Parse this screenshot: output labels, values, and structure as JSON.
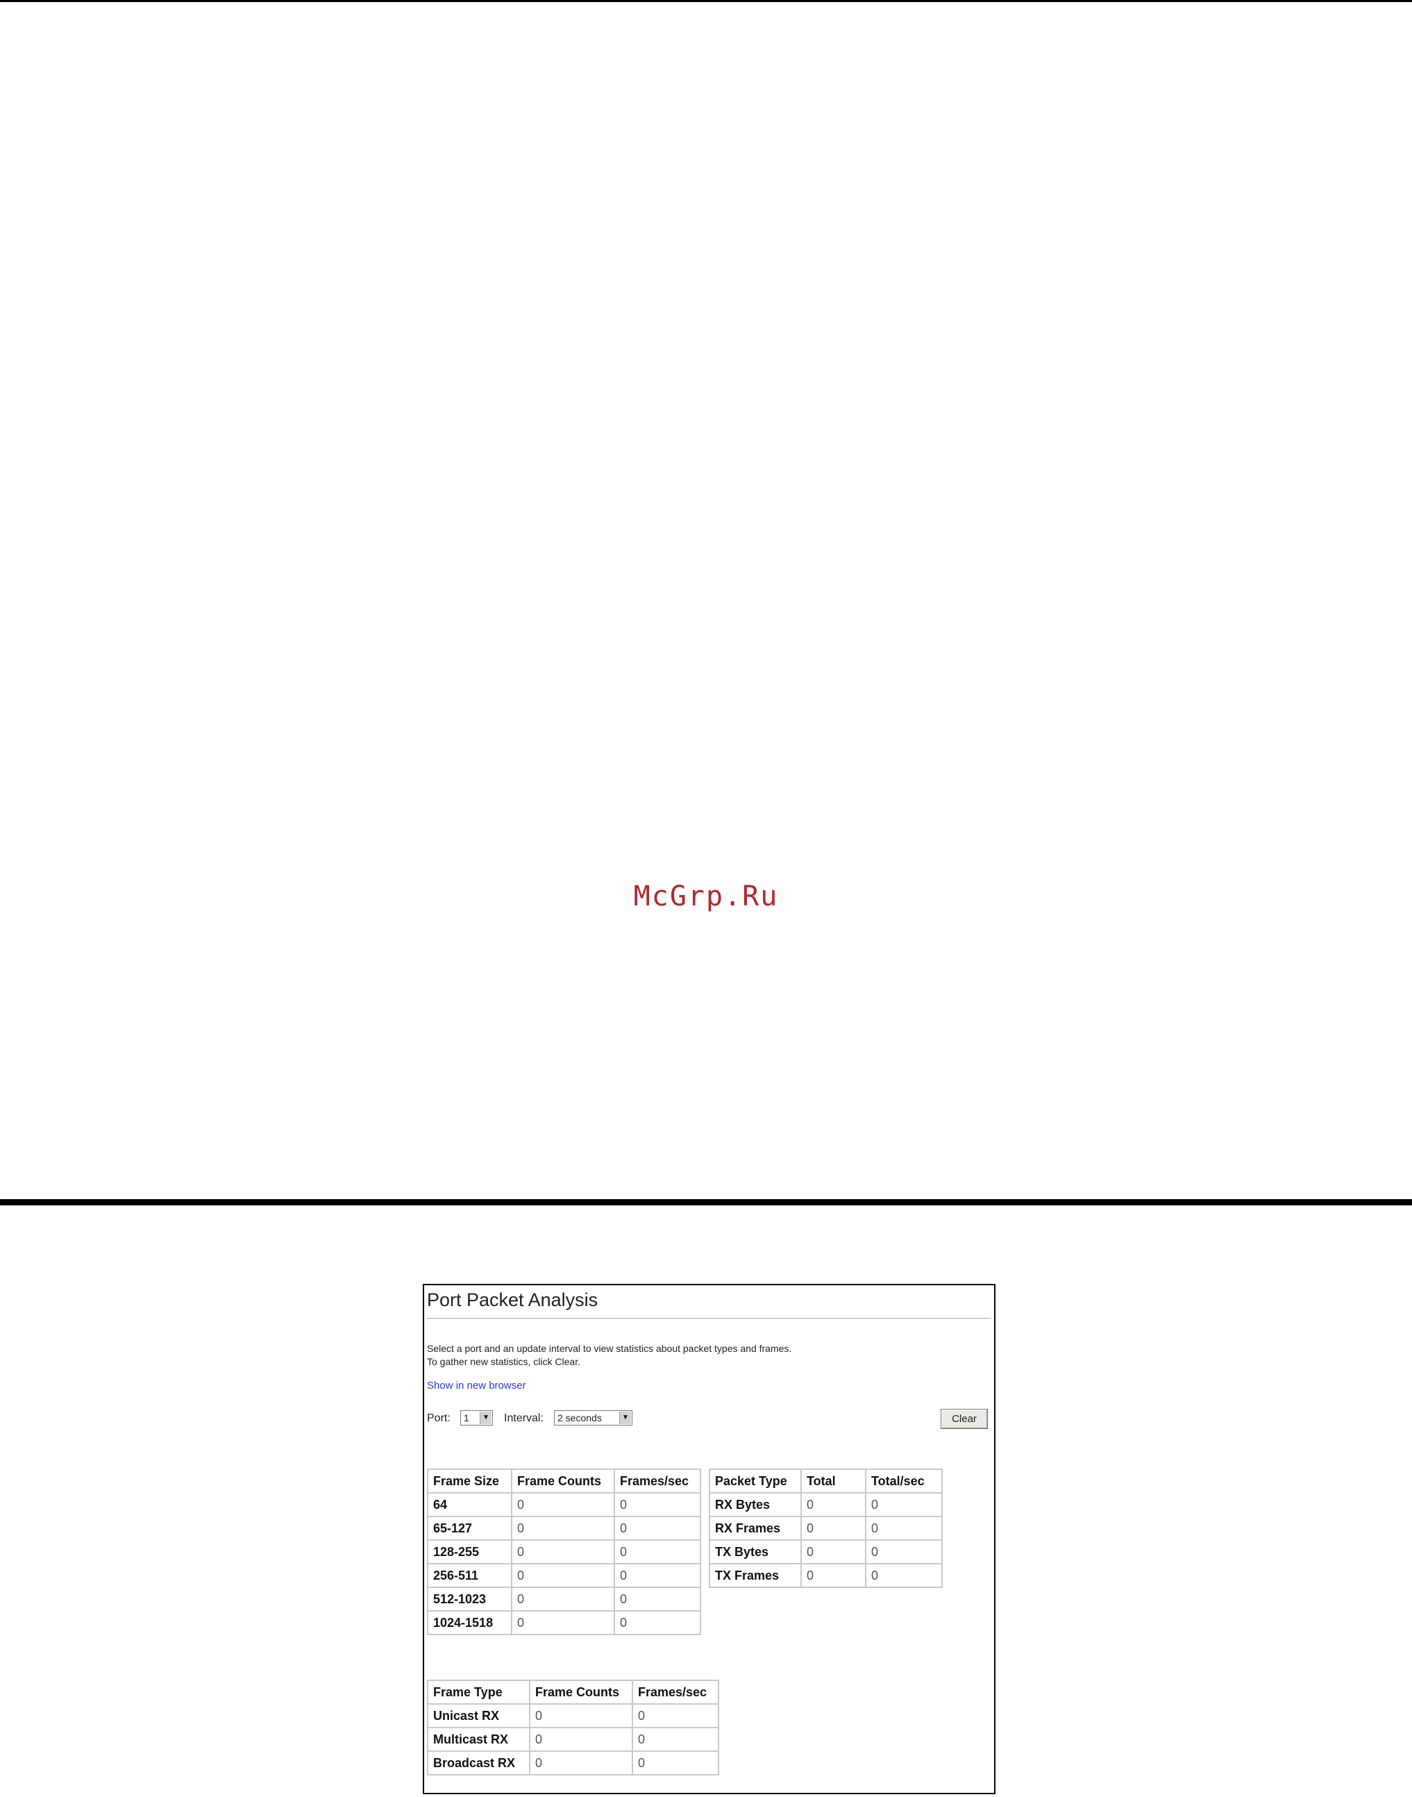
{
  "watermark": "McGrp.Ru",
  "panel": {
    "title": "Port Packet Analysis",
    "description_line1": "Select a port and an update interval to view statistics about packet types and frames.",
    "description_line2": "To gather new statistics, click Clear.",
    "link": "Show in new browser",
    "port_label": "Port:",
    "port_value": "1",
    "interval_label": "Interval:",
    "interval_value": "2 seconds",
    "clear_label": "Clear"
  },
  "frame_size_table": {
    "headers": [
      "Frame Size",
      "Frame Counts",
      "Frames/sec"
    ],
    "rows": [
      [
        "64",
        "0",
        "0"
      ],
      [
        "65-127",
        "0",
        "0"
      ],
      [
        "128-255",
        "0",
        "0"
      ],
      [
        "256-511",
        "0",
        "0"
      ],
      [
        "512-1023",
        "0",
        "0"
      ],
      [
        "1024-1518",
        "0",
        "0"
      ]
    ]
  },
  "packet_type_table": {
    "headers": [
      "Packet Type",
      "Total",
      "Total/sec"
    ],
    "rows": [
      [
        "RX Bytes",
        "0",
        "0"
      ],
      [
        "RX Frames",
        "0",
        "0"
      ],
      [
        "TX Bytes",
        "0",
        "0"
      ],
      [
        "TX Frames",
        "0",
        "0"
      ]
    ]
  },
  "frame_type_table": {
    "headers": [
      "Frame Type",
      "Frame Counts",
      "Frames/sec"
    ],
    "rows": [
      [
        "Unicast RX",
        "0",
        "0"
      ],
      [
        "Multicast RX",
        "0",
        "0"
      ],
      [
        "Broadcast RX",
        "0",
        "0"
      ]
    ]
  }
}
